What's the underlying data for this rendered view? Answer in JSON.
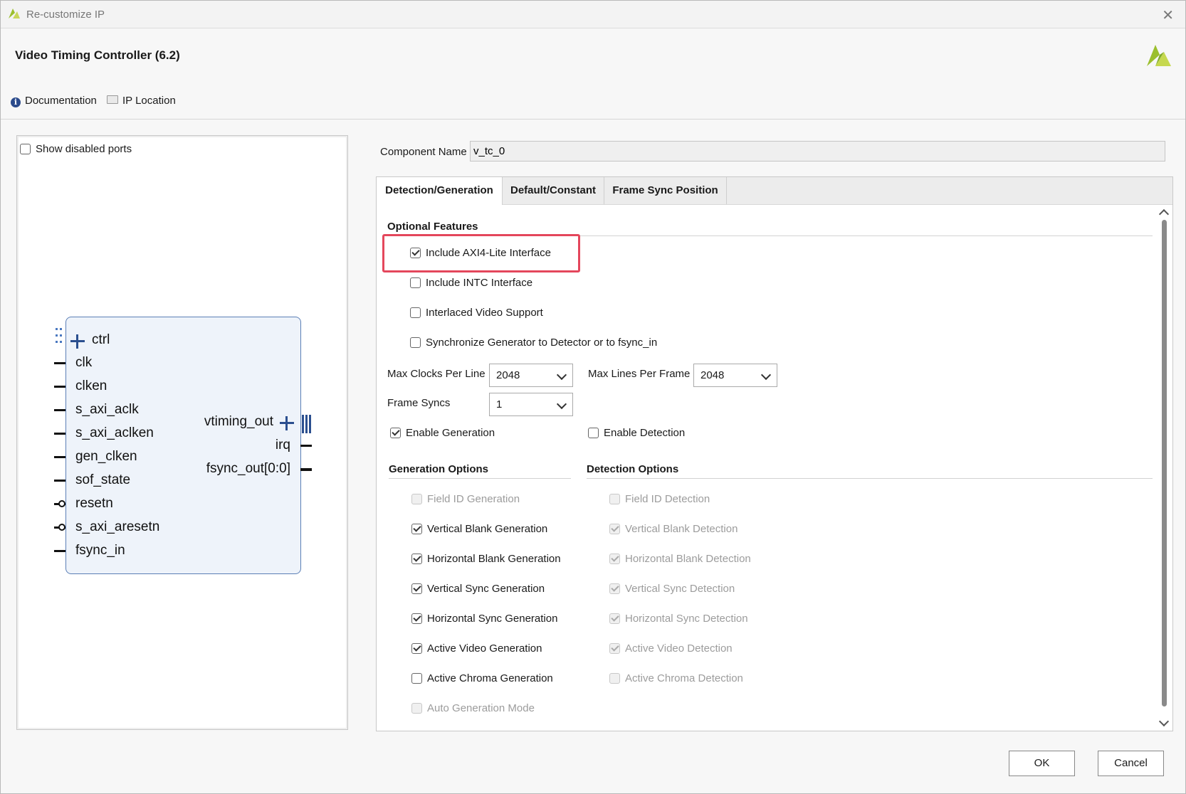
{
  "window": {
    "title": "Re-customize IP"
  },
  "header": {
    "ip_title": "Video Timing Controller (6.2)",
    "documentation": "Documentation",
    "ip_location": "IP Location"
  },
  "left_panel": {
    "show_disabled_ports": "Show disabled ports",
    "show_disabled_checked": false,
    "block": {
      "left_ports": [
        "ctrl",
        "clk",
        "clken",
        "s_axi_aclk",
        "s_axi_aclken",
        "gen_clken",
        "sof_state",
        "resetn",
        "s_axi_aresetn",
        "fsync_in"
      ],
      "right_ports": [
        "vtiming_out",
        "irq",
        "fsync_out[0:0]"
      ]
    }
  },
  "component": {
    "label": "Component Name",
    "value": "v_tc_0"
  },
  "tabs": [
    {
      "label": "Detection/Generation",
      "active": true
    },
    {
      "label": "Default/Constant",
      "active": false
    },
    {
      "label": "Frame Sync Position",
      "active": false
    }
  ],
  "optional_features": {
    "title": "Optional Features",
    "items": [
      {
        "label": "Include AXI4-Lite Interface",
        "checked": true
      },
      {
        "label": "Include INTC Interface",
        "checked": false
      },
      {
        "label": "Interlaced Video Support",
        "checked": false
      },
      {
        "label": "Synchronize Generator to Detector or to fsync_in",
        "checked": false
      }
    ]
  },
  "params": {
    "max_clocks_label": "Max Clocks Per Line",
    "max_clocks_value": "2048",
    "max_lines_label": "Max Lines Per Frame",
    "max_lines_value": "2048",
    "frame_syncs_label": "Frame Syncs",
    "frame_syncs_value": "1"
  },
  "enable": {
    "generation": {
      "label": "Enable Generation",
      "checked": true
    },
    "detection": {
      "label": "Enable Detection",
      "checked": false
    }
  },
  "generation_options": {
    "title": "Generation Options",
    "items": [
      {
        "label": "Field ID Generation",
        "checked": false,
        "disabled": true
      },
      {
        "label": "Vertical Blank Generation",
        "checked": true,
        "disabled": false
      },
      {
        "label": "Horizontal Blank Generation",
        "checked": true,
        "disabled": false
      },
      {
        "label": "Vertical Sync Generation",
        "checked": true,
        "disabled": false
      },
      {
        "label": "Horizontal Sync Generation",
        "checked": true,
        "disabled": false
      },
      {
        "label": "Active Video Generation",
        "checked": true,
        "disabled": false
      },
      {
        "label": "Active Chroma Generation",
        "checked": false,
        "disabled": false
      },
      {
        "label": "Auto Generation Mode",
        "checked": false,
        "disabled": true
      }
    ]
  },
  "detection_options": {
    "title": "Detection Options",
    "items": [
      {
        "label": "Field ID Detection",
        "checked": false,
        "disabled": true
      },
      {
        "label": "Vertical Blank Detection",
        "checked": true,
        "disabled": true
      },
      {
        "label": "Horizontal Blank Detection",
        "checked": true,
        "disabled": true
      },
      {
        "label": "Vertical Sync Detection",
        "checked": true,
        "disabled": true
      },
      {
        "label": "Horizontal Sync Detection",
        "checked": true,
        "disabled": true
      },
      {
        "label": "Active Video Detection",
        "checked": true,
        "disabled": true
      },
      {
        "label": "Active Chroma Detection",
        "checked": false,
        "disabled": true
      }
    ]
  },
  "footer": {
    "ok": "OK",
    "cancel": "Cancel"
  },
  "colors": {
    "highlight": "#e4475c",
    "block_border": "#5b7fb6",
    "logo": "#9bbf2d"
  }
}
